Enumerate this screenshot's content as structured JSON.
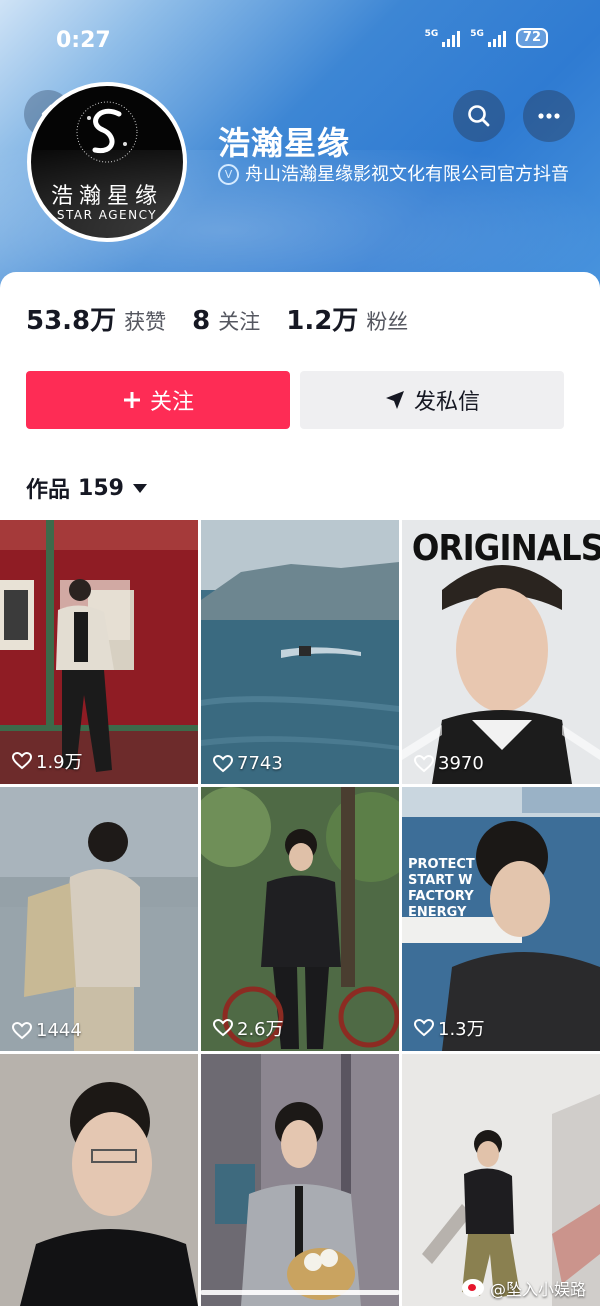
{
  "status_bar": {
    "time": "0:27",
    "network_1": "5G",
    "network_2": "5G",
    "battery": "72"
  },
  "header": {
    "avatar_text_cn": "浩瀚星缘",
    "avatar_text_en": "STAR AGENCY",
    "name": "浩瀚星缘",
    "verification": "舟山浩瀚星缘影视文化有限公司官方抖音",
    "icons": [
      "back-icon",
      "search-icon",
      "more-icon",
      "verified-icon"
    ]
  },
  "stats": [
    {
      "value": "53.8万",
      "label": "获赞"
    },
    {
      "value": "8",
      "label": "关注"
    },
    {
      "value": "1.2万",
      "label": "粉丝"
    }
  ],
  "buttons": {
    "follow": "关注",
    "message": "发私信"
  },
  "works": {
    "label": "作品",
    "count": "159"
  },
  "videos": [
    {
      "likes": "1.9万",
      "overlay_text": ""
    },
    {
      "likes": "7743",
      "overlay_text": ""
    },
    {
      "likes": "3970",
      "overlay_text": "ORIGINALS"
    },
    {
      "likes": "1444",
      "overlay_text": ""
    },
    {
      "likes": "2.6万",
      "overlay_text": ""
    },
    {
      "likes": "1.3万",
      "overlay_text": "PROTECT START W FACTORY ENERGY"
    },
    {
      "likes": "",
      "overlay_text": ""
    },
    {
      "likes": "",
      "overlay_text": ""
    },
    {
      "likes": "",
      "overlay_text": ""
    }
  ],
  "watermark": "@坠入小娱路",
  "colors": {
    "accent": "#fe2c55",
    "header_blue": "#3d86d4"
  }
}
